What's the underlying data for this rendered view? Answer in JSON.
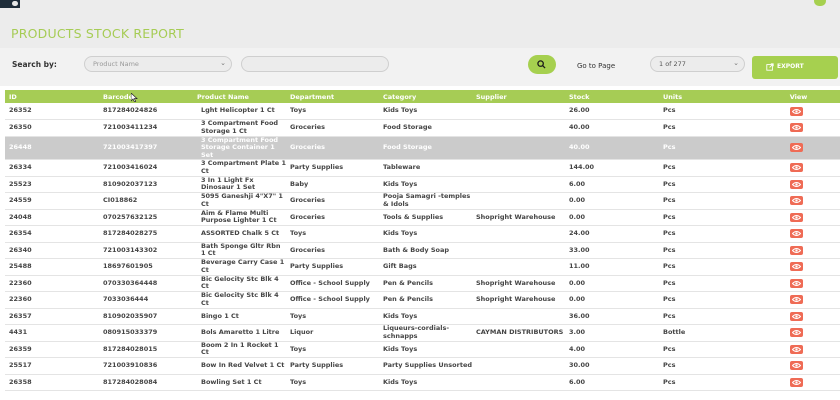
{
  "page": {
    "title": "PRODUCTS STOCK REPORT"
  },
  "search": {
    "label": "Search by:",
    "field_select": "Product Name",
    "query_placeholder": "",
    "goto_label": "Go to Page",
    "page_select": "1 of 277",
    "export_label": "EXPORT"
  },
  "table": {
    "headers": [
      "ID",
      "Barcode",
      "Product Name",
      "Department",
      "Category",
      "Supplier",
      "Stock",
      "Units",
      "View"
    ],
    "rows": [
      [
        "26352",
        "817284024826",
        "Lght Helicopter 1 Ct",
        "Toys",
        "Kids Toys",
        "",
        "26.00",
        "Pcs"
      ],
      [
        "26350",
        "721003411234",
        "3 Compartment Food Storage 1 Ct",
        "Groceries",
        "Food Storage",
        "",
        "40.00",
        "Pcs"
      ],
      [
        "26448",
        "721003417397",
        "3 Compartment Food Storage Container 1 Set",
        "Groceries",
        "Food Storage",
        "",
        "40.00",
        "Pcs"
      ],
      [
        "26334",
        "721003416024",
        "3 Compartment Plate 1 Ct",
        "Party Supplies",
        "Tableware",
        "",
        "144.00",
        "Pcs"
      ],
      [
        "25523",
        "810902037123",
        "3 In 1 Light Fx Dinosaur 1 Set",
        "Baby",
        "Kids Toys",
        "",
        "6.00",
        "Pcs"
      ],
      [
        "24559",
        "CI018862",
        "5095 Ganeshji 4\"X7\" 1 Ct",
        "Groceries",
        "Pooja Samagri -temples & Idols",
        "",
        "0.00",
        "Pcs"
      ],
      [
        "24048",
        "070257632125",
        "Aim & Flame Multi Purpose Lighter 1 Ct",
        "Groceries",
        "Tools & Supplies",
        "Shopright Warehouse",
        "0.00",
        "Pcs"
      ],
      [
        "26354",
        "817284028275",
        "ASSORTED Chalk 5 Ct",
        "Toys",
        "Kids Toys",
        "",
        "24.00",
        "Pcs"
      ],
      [
        "26340",
        "721003143302",
        "Bath Sponge Gltr Rbn 1 Ct",
        "Groceries",
        "Bath & Body Soap",
        "",
        "33.00",
        "Pcs"
      ],
      [
        "25488",
        "18697601905",
        "Beverage Carry Case 1 Ct",
        "Party Supplies",
        "Gift Bags",
        "",
        "11.00",
        "Pcs"
      ],
      [
        "22360",
        "070330364448",
        "Bic Gelocity Stc Blk 4 Ct",
        "Office - School Supply",
        "Pen & Pencils",
        "Shopright Warehouse",
        "0.00",
        "Pcs"
      ],
      [
        "22360",
        "7033036444",
        "Bic Gelocity Stc Blk 4 Ct",
        "Office - School Supply",
        "Pen & Pencils",
        "Shopright Warehouse",
        "0.00",
        "Pcs"
      ],
      [
        "26357",
        "810902035907",
        "Bingo 1 Ct",
        "Toys",
        "Kids Toys",
        "",
        "36.00",
        "Pcs"
      ],
      [
        "4431",
        "080915033379",
        "Bols Amaretto 1 Litre",
        "Liquor",
        "Liqueurs-cordials-schnapps",
        "CAYMAN DISTRIBUTORS",
        "3.00",
        "Bottle"
      ],
      [
        "26359",
        "817284028015",
        "Boom 2 In 1 Rocket 1 Ct",
        "Toys",
        "Kids Toys",
        "",
        "4.00",
        "Pcs"
      ],
      [
        "25517",
        "721003910836",
        "Bow In Red Velvet 1 Ct",
        "Party Supplies",
        "Party Supplies Unsorted",
        "",
        "30.00",
        "Pcs"
      ],
      [
        "26358",
        "817284028084",
        "Bowling Set 1 Ct",
        "Toys",
        "Kids Toys",
        "",
        "6.00",
        "Pcs"
      ]
    ],
    "highlighted_row": 2
  },
  "colors": {
    "accent": "#a6cc55",
    "view_button": "#ef6b55",
    "highlight_row": "#cbcbcb"
  },
  "icons": {
    "search": "search-icon",
    "export": "export-icon",
    "view": "eye-icon",
    "dropdown": "chevron-down-icon"
  }
}
